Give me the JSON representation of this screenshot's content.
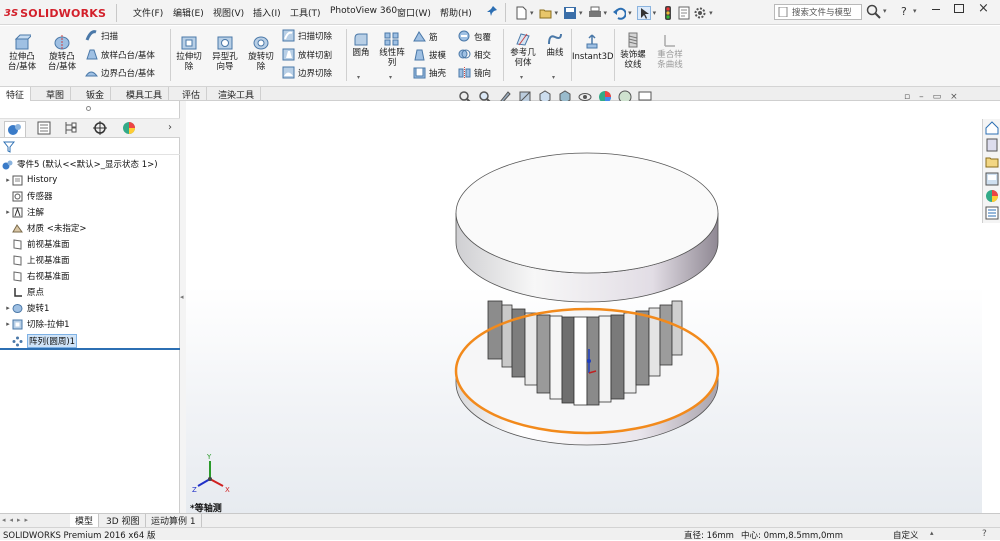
{
  "app": {
    "logo_ds": "3S",
    "logo_text": "SOLIDWORKS",
    "brand_color": "#d3202b"
  },
  "menus": [
    "文件(F)",
    "编辑(E)",
    "视图(V)",
    "插入(I)",
    "工具(T)",
    "PhotoView 360",
    "窗口(W)",
    "帮助(H)"
  ],
  "search": {
    "placeholder": "搜索文件与模型"
  },
  "help_label": "?",
  "commands": {
    "extrude_boss": "拉伸凸\n台/基体",
    "revolve_boss": "旋转凸\n台/基体",
    "sweep": "扫描",
    "loft_boss": "放样凸台/基体",
    "boundary_boss": "边界凸台/基体",
    "extrude_cut": "拉伸切\n除",
    "hole_wizard": "异型孔\n向导",
    "revolve_cut": "旋转切\n除",
    "swept_cut": "扫描切除",
    "lofted_cut": "放样切割",
    "boundary_cut": "边界切除",
    "fillet": "圆角",
    "linear_pattern": "线性阵\n列",
    "rib": "筋",
    "draft": "拔模",
    "shell": "抽壳",
    "wrap": "包覆",
    "intersect": "相交",
    "mirror": "镜向",
    "ref_geometry": "参考几\n何体",
    "curves": "曲线",
    "instant3d": "Instant3D",
    "cosmetic_thread": "装饰螺\n纹线",
    "muscle": "重合样\n条曲线"
  },
  "cm_tabs": [
    "特征",
    "草图",
    "钣金",
    "模具工具",
    "评估",
    "渲染工具"
  ],
  "tree": {
    "root": "零件5 (默认<<默认>_显示状态 1>)",
    "items": [
      {
        "label": "History",
        "arrow": "▸",
        "icon": "history-icon"
      },
      {
        "label": "传感器",
        "arrow": "",
        "icon": "sensor-icon"
      },
      {
        "label": "注解",
        "arrow": "▸",
        "icon": "annotation-icon"
      },
      {
        "label": "材质 <未指定>",
        "arrow": "",
        "icon": "material-icon"
      },
      {
        "label": "前视基准面",
        "arrow": "",
        "icon": "plane-icon"
      },
      {
        "label": "上视基准面",
        "arrow": "",
        "icon": "plane-icon"
      },
      {
        "label": "右视基准面",
        "arrow": "",
        "icon": "plane-icon"
      },
      {
        "label": "原点",
        "arrow": "",
        "icon": "origin-icon"
      },
      {
        "label": "旋转1",
        "arrow": "▸",
        "icon": "revolve-feature-icon"
      },
      {
        "label": "切除-拉伸1",
        "arrow": "▸",
        "icon": "cut-extrude-feature-icon"
      },
      {
        "label": "阵列(圆周)1",
        "arrow": "",
        "icon": "circular-pattern-icon"
      }
    ]
  },
  "view": {
    "label": "*等轴测",
    "axis_x": "X",
    "axis_y": "Y",
    "axis_z": "Z"
  },
  "bottom_tabs": [
    "模型",
    "3D 视图",
    "运动算例 1"
  ],
  "status": {
    "product": "SOLIDWORKS Premium 2016 x64 版",
    "diameter": "直径: 16mm",
    "center": "中心: 0mm,8.5mm,0mm",
    "units": "自定义"
  },
  "colors": {
    "selection": "#f28a1c",
    "accent": "#2c6fb3"
  }
}
